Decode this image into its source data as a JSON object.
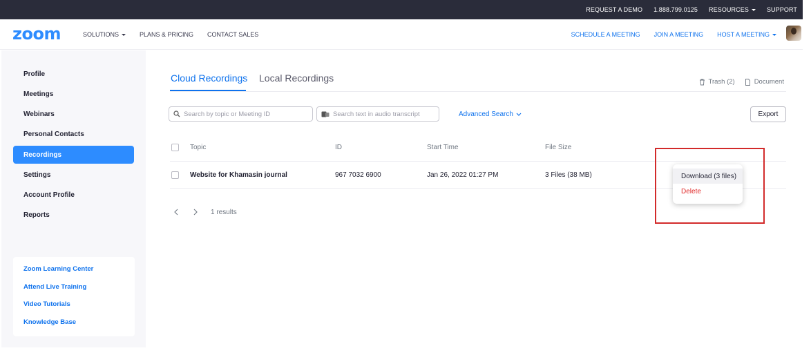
{
  "topbar": {
    "request_demo": "REQUEST A DEMO",
    "phone": "1.888.799.0125",
    "resources": "RESOURCES",
    "support": "SUPPORT"
  },
  "nav": {
    "logo": "zoom",
    "solutions": "SOLUTIONS",
    "plans": "PLANS & PRICING",
    "contact": "CONTACT SALES",
    "schedule": "SCHEDULE A MEETING",
    "join": "JOIN A MEETING",
    "host": "HOST A MEETING"
  },
  "sidebar": {
    "items": [
      {
        "label": "Profile"
      },
      {
        "label": "Meetings"
      },
      {
        "label": "Webinars"
      },
      {
        "label": "Personal Contacts"
      },
      {
        "label": "Recordings",
        "active": true
      },
      {
        "label": "Settings"
      },
      {
        "label": "Account Profile"
      },
      {
        "label": "Reports"
      }
    ],
    "learning": [
      {
        "label": "Zoom Learning Center"
      },
      {
        "label": "Attend Live Training"
      },
      {
        "label": "Video Tutorials"
      },
      {
        "label": "Knowledge Base"
      }
    ]
  },
  "main": {
    "tabs": {
      "cloud": "Cloud Recordings",
      "local": "Local Recordings"
    },
    "trash": "Trash (2)",
    "document": "Document",
    "search_placeholder": "Search by topic or Meeting ID",
    "transcript_placeholder": "Search text in audio transcript",
    "advanced_search": "Advanced Search",
    "export": "Export",
    "columns": {
      "topic": "Topic",
      "id": "ID",
      "start": "Start Time",
      "size": "File Size"
    },
    "rows": [
      {
        "topic": "Website for Khamasin journal",
        "id": "967 7032 6900",
        "start": "Jan 26, 2022 01:27 PM",
        "size": "3 Files (38 MB)"
      }
    ],
    "results": "1 results",
    "dropdown": {
      "download": "Download (3 files)",
      "delete": "Delete"
    }
  },
  "colors": {
    "brand": "#2d8cff",
    "link": "#0e72ed",
    "topbar": "#2a2c3a",
    "delete": "#e02828",
    "highlight_box": "#d22a2a"
  }
}
